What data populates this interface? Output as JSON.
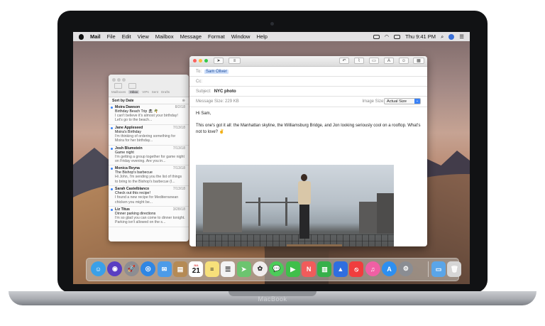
{
  "device": {
    "brand_label": "MacBook"
  },
  "menubar": {
    "app_name": "Mail",
    "items": [
      "File",
      "Edit",
      "View",
      "Mailbox",
      "Message",
      "Format",
      "Window",
      "Help"
    ],
    "clock": "Thu 9:41 PM",
    "status_icons": [
      "airplay-icon",
      "wifi-icon",
      "battery-icon",
      "clock-time",
      "spotlight-icon",
      "user-avatar-icon",
      "notification-icon"
    ]
  },
  "mailbox_window": {
    "tabs": [
      "Mailboxes",
      "Inbox",
      "VIPs",
      "Sent",
      "Drafts"
    ],
    "active_tab": "Inbox",
    "sort_label": "Sort by Date",
    "messages": [
      {
        "from": "Moira Dawson",
        "date": "8/2/18",
        "subject": "Birthday Beach Trip 🏖 🌴",
        "preview": "I can't believe it's almost your birthday! Let's go to the beach..."
      },
      {
        "from": "Jane Appleseed",
        "date": "7/13/18",
        "subject": "Moira's Birthday",
        "preview": "I'm thinking of ordering something for Moira for her birthday..."
      },
      {
        "from": "Josh Blumstein",
        "date": "7/13/18",
        "subject": "Game night",
        "preview": "I'm getting a group together for game night on Friday evening. Are you in..."
      },
      {
        "from": "Monica Reyna",
        "date": "7/13/18",
        "subject": "The Bishop's barbecue",
        "preview": "Hi John, I'm sending you the list of things to bring to the Bishop's barbecue (I..."
      },
      {
        "from": "Sarah Castelblanco",
        "date": "7/13/18",
        "subject": "Check out this recipe!",
        "preview": "I found a new recipe for Mediterranean chicken you might be..."
      },
      {
        "from": "Liz Titus",
        "date": "3/28/18",
        "subject": "Dinner parking directions",
        "preview": "I'm so glad you can come to dinner tonight. Parking isn't allowed on the s..."
      }
    ]
  },
  "compose": {
    "to_label": "To:",
    "to_value": "Sam Oliver",
    "cc_label": "Cc:",
    "subject_label": "Subject:",
    "subject_value": "NYC photo",
    "message_size_label": "Message Size:",
    "message_size_value": "229 KB",
    "image_size_label": "Image Size:",
    "image_size_value": "Actual Size",
    "greeting": "Hi Sam,",
    "body": "This one's got it all: the Manhattan skyline, the Williamsburg Bridge, and Jon looking seriously cool on a rooftop. What's not to love? ✌",
    "toolbar": {
      "send_icon": "send-icon",
      "format_label": "≡",
      "font_label": "A"
    }
  },
  "dock": {
    "apps": [
      {
        "name": "finder",
        "color": "#3aa0e8",
        "glyph": "☺"
      },
      {
        "name": "siri",
        "color": "#5a3ec2",
        "glyph": "◉"
      },
      {
        "name": "launchpad",
        "color": "#8d8d92",
        "glyph": "🚀"
      },
      {
        "name": "safari",
        "color": "#2f86e3",
        "glyph": "◎"
      },
      {
        "name": "mail",
        "color": "#4c9be8",
        "glyph": "✉"
      },
      {
        "name": "contacts",
        "color": "#b58a55",
        "glyph": "▤"
      },
      {
        "name": "calendar",
        "color": "#ffffff",
        "glyph": "21"
      },
      {
        "name": "notes",
        "color": "#f7e07a",
        "glyph": "≡"
      },
      {
        "name": "reminders",
        "color": "#f3f3f3",
        "glyph": "☰"
      },
      {
        "name": "maps",
        "color": "#6cc46f",
        "glyph": "➤"
      },
      {
        "name": "photos",
        "color": "#f0eded",
        "glyph": "✿"
      },
      {
        "name": "messages",
        "color": "#4ccb59",
        "glyph": "💬"
      },
      {
        "name": "facetime",
        "color": "#3fbf4a",
        "glyph": "▶"
      },
      {
        "name": "news",
        "color": "#f15b5b",
        "glyph": "N"
      },
      {
        "name": "numbers",
        "color": "#36b04a",
        "glyph": "▥"
      },
      {
        "name": "keynote",
        "color": "#2f6ee0",
        "glyph": "▲"
      },
      {
        "name": "news-red",
        "color": "#f03d3d",
        "glyph": "⦸"
      },
      {
        "name": "itunes",
        "color": "#f05fa4",
        "glyph": "♫"
      },
      {
        "name": "app-store",
        "color": "#2d8ff0",
        "glyph": "A"
      },
      {
        "name": "system-preferences",
        "color": "#8a8d93",
        "glyph": "⚙"
      }
    ],
    "right_items": [
      {
        "name": "downloads-folder",
        "color": "#5aa5e8",
        "glyph": "▭"
      },
      {
        "name": "trash",
        "color": "#d6d6d6",
        "glyph": "🗑"
      }
    ]
  }
}
